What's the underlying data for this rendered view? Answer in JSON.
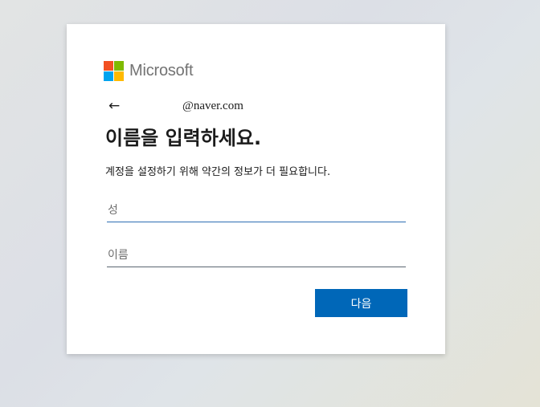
{
  "brand": {
    "name": "Microsoft",
    "logo_colors": [
      "#f25022",
      "#7fba00",
      "#00a4ef",
      "#ffb900"
    ]
  },
  "identity": {
    "back_icon": "back-arrow-icon",
    "back_glyph": "←",
    "email": "@naver.com"
  },
  "form": {
    "title": "이름을 입력하세요.",
    "description": "계정을 설정하기 위해 약간의 정보가 더 필요합니다.",
    "last_name_placeholder": "성",
    "last_name_value": "",
    "first_name_placeholder": "이름",
    "first_name_value": "",
    "next_label": "다음"
  },
  "colors": {
    "primary_button": "#0067b8",
    "focused_underline": "#2d6eb3"
  }
}
